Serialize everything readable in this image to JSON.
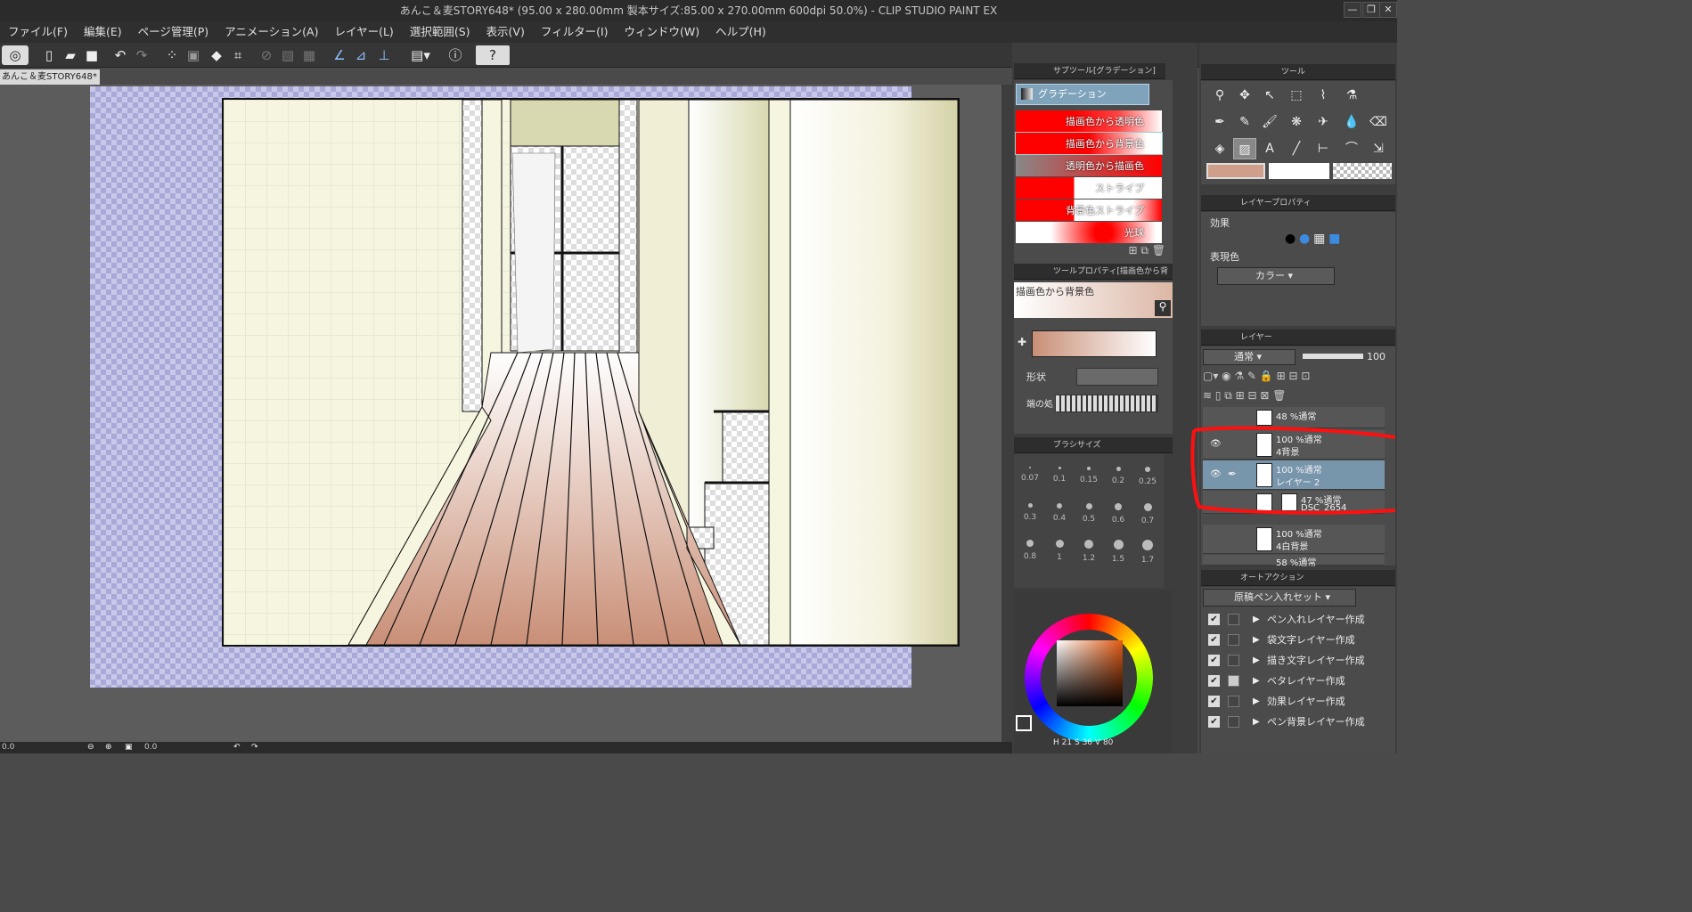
{
  "window": {
    "title": "あんこ＆麦STORY648* (95.00 x 280.00mm 製本サイズ:85.00 x 270.00mm 600dpi 50.0%)  - CLIP STUDIO PAINT EX"
  },
  "menu": [
    "ファイル(F)",
    "編集(E)",
    "ページ管理(P)",
    "アニメーション(A)",
    "レイヤー(L)",
    "選択範囲(S)",
    "表示(V)",
    "フィルター(I)",
    "ウィンドウ(W)",
    "ヘルプ(H)"
  ],
  "document": {
    "tab": "あんこ＆麦STORY648*"
  },
  "status": {
    "zoom_left": "0.0",
    "zoom_mid": "0.0"
  },
  "subtool": {
    "header": "サブツール[グラデーション]",
    "group": "グラデーション",
    "items": [
      "描画色から透明色",
      "描画色から背景色",
      "透明色から描画色",
      "ストライプ",
      "背景色ストライプ",
      "光球"
    ]
  },
  "toolprop": {
    "header": "ツールプロパティ[描画色から背景",
    "preset": "描画色から背景色",
    "shape_label": "形状",
    "edge_label": "端の処"
  },
  "brushsize": {
    "header": "ブラシサイズ",
    "sizes": [
      "0.07",
      "0.1",
      "0.15",
      "0.2",
      "0.25",
      "0.3",
      "0.4",
      "0.5",
      "0.6",
      "0.7",
      "0.8",
      "1",
      "1.2",
      "1.5",
      "1.7"
    ]
  },
  "color": {
    "h": "21",
    "s": "36",
    "v": "80",
    "h_label": "H",
    "s_label": "S",
    "v_label": "V",
    "main": "#cf9f8c",
    "sub": "#ffffff"
  },
  "tools": {
    "header": "ツール"
  },
  "layerprop": {
    "header": "レイヤープロパティ",
    "effect_label": "効果",
    "express_label": "表現色",
    "express_value": "カラー"
  },
  "layers": {
    "header": "レイヤー",
    "blend": "通常",
    "opacity": "100",
    "items": [
      {
        "l1": "48 %通常",
        "l2": ""
      },
      {
        "l1": "100 %通常",
        "l2": "4背景"
      },
      {
        "l1": "100 %通常",
        "l2": "レイヤー 2"
      },
      {
        "l1": "47 %通常",
        "l2": "DSC_2654"
      },
      {
        "l1": "100 %通常",
        "l2": "4白背景"
      },
      {
        "l1": "58 %通常",
        "l2": ""
      }
    ]
  },
  "autoaction": {
    "header": "オートアクション",
    "set": "原稿ペン入れセット",
    "items": [
      "ペン入れレイヤー作成",
      "袋文字レイヤー作成",
      "描き文字レイヤー作成",
      "ベタレイヤー作成",
      "効果レイヤー作成",
      "ペン背景レイヤー作成"
    ]
  }
}
